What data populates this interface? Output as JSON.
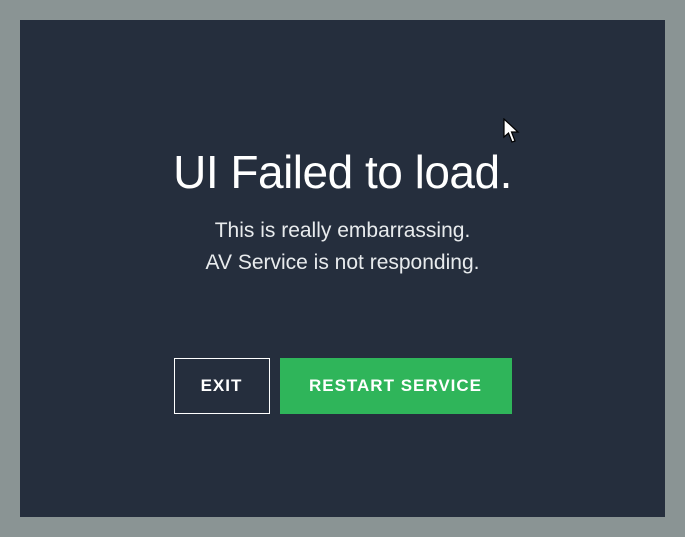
{
  "dialog": {
    "title": "UI Failed to load.",
    "subtitle_line1": "This is really embarrassing.",
    "subtitle_line2": "AV Service is not responding.",
    "buttons": {
      "exit": "EXIT",
      "restart": "RESTART SERVICE"
    }
  }
}
